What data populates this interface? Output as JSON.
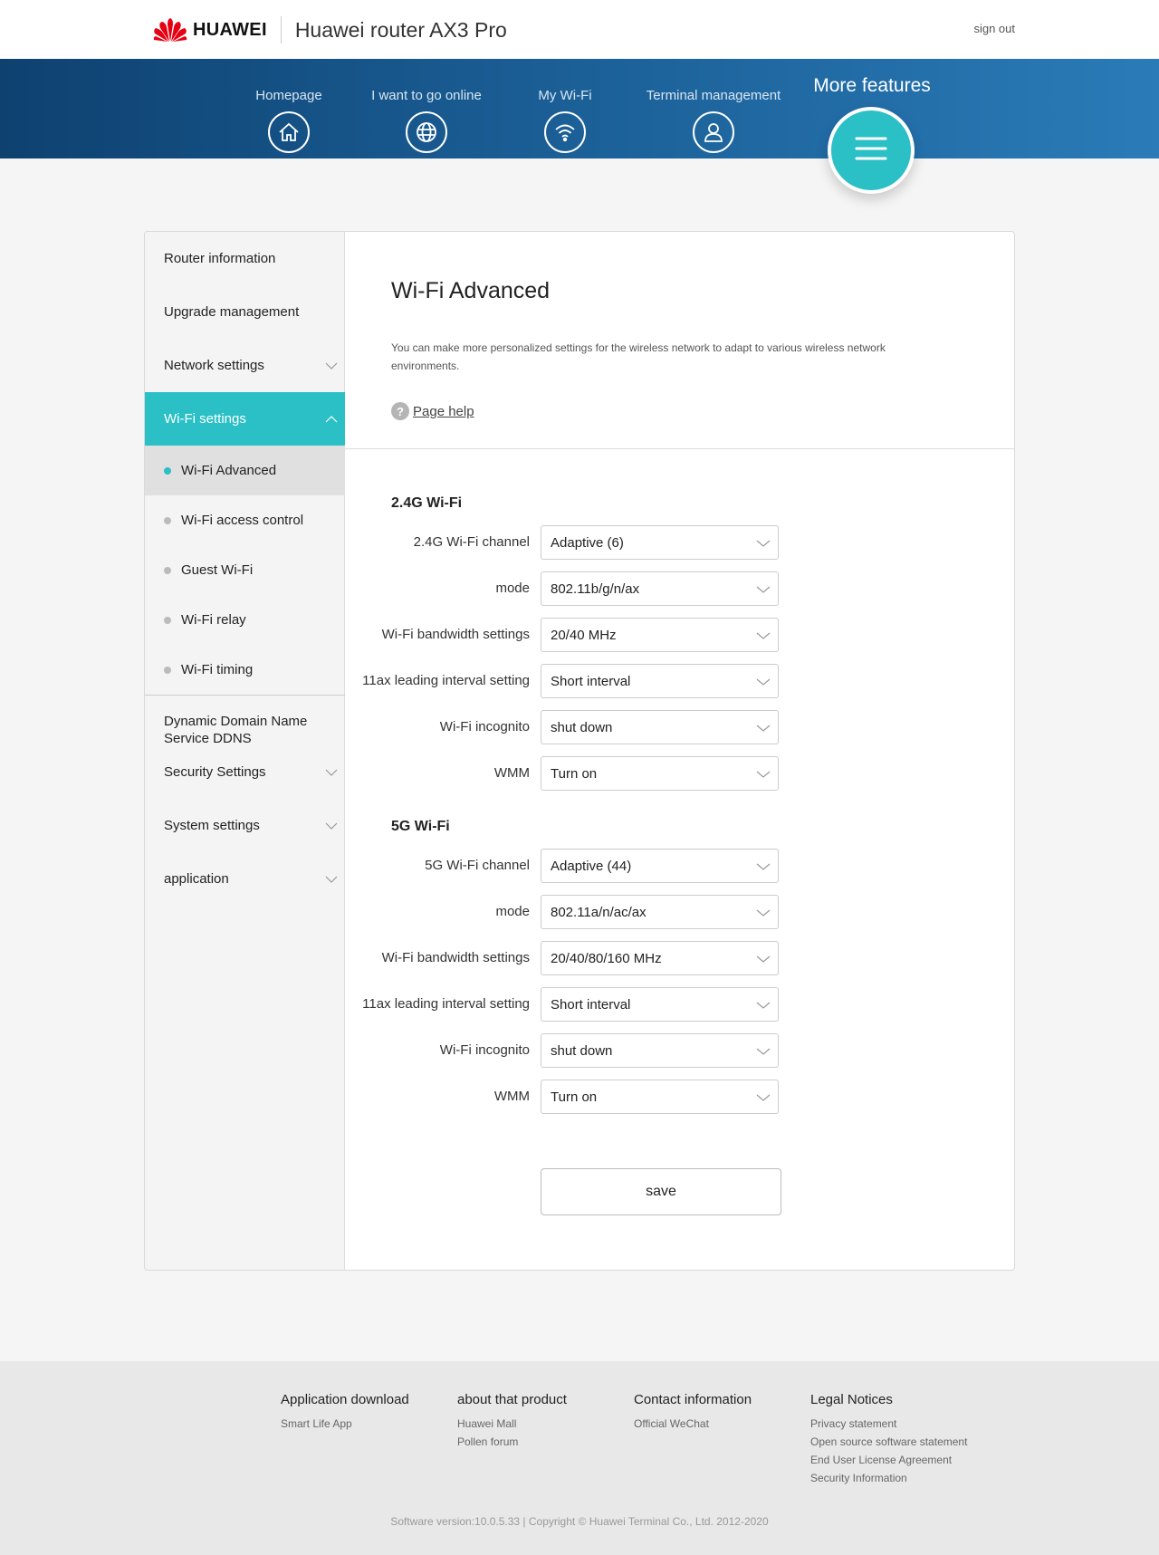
{
  "header": {
    "brand": "HUAWEI",
    "title": "Huawei router AX3 Pro",
    "signout": "sign out"
  },
  "nav": {
    "items": [
      {
        "label": "Homepage",
        "icon": "home-icon"
      },
      {
        "label": "I want to go online",
        "icon": "globe-icon"
      },
      {
        "label": "My Wi-Fi",
        "icon": "wifi-icon"
      },
      {
        "label": "Terminal management",
        "icon": "user-icon"
      }
    ],
    "more_label": "More features",
    "more_icon": "menu-icon"
  },
  "sidebar": {
    "router_info": "Router information",
    "upgrade": "Upgrade management",
    "network": "Network settings",
    "wifi": "Wi-Fi settings",
    "sub": [
      "Wi-Fi Advanced",
      "Wi-Fi access control",
      "Guest Wi-Fi",
      "Wi-Fi relay",
      "Wi-Fi timing"
    ],
    "ddns": "Dynamic Domain Name Service DDNS",
    "security": "Security Settings",
    "system": "System settings",
    "application": "application"
  },
  "page": {
    "title": "Wi-Fi Advanced",
    "description": "You can make more personalized settings for the wireless network to adapt to various wireless network environments.",
    "help": "Page help"
  },
  "wifi24": {
    "title": "2.4G Wi-Fi",
    "rows": [
      {
        "label": "2.4G Wi-Fi channel",
        "value": "Adaptive (6)"
      },
      {
        "label": "mode",
        "value": "802.11b/g/n/ax"
      },
      {
        "label": "Wi-Fi bandwidth settings",
        "value": "20/40 MHz"
      },
      {
        "label": "11ax leading interval setting",
        "value": "Short interval"
      },
      {
        "label": "Wi-Fi incognito",
        "value": "shut down"
      },
      {
        "label": "WMM",
        "value": "Turn on"
      }
    ]
  },
  "wifi5": {
    "title": "5G Wi-Fi",
    "rows": [
      {
        "label": "5G Wi-Fi channel",
        "value": "Adaptive (44)"
      },
      {
        "label": "mode",
        "value": "802.11a/n/ac/ax"
      },
      {
        "label": "Wi-Fi bandwidth settings",
        "value": "20/40/80/160 MHz"
      },
      {
        "label": "11ax leading interval setting",
        "value": "Short interval"
      },
      {
        "label": "Wi-Fi incognito",
        "value": "shut down"
      },
      {
        "label": "WMM",
        "value": "Turn on"
      }
    ]
  },
  "save_label": "save",
  "footer": {
    "cols": [
      {
        "head": "Application download",
        "links": [
          "Smart Life App"
        ]
      },
      {
        "head": "about that product",
        "links": [
          "Huawei Mall",
          "Pollen forum"
        ]
      },
      {
        "head": "Contact information",
        "links": [
          "Official WeChat"
        ]
      },
      {
        "head": "Legal Notices",
        "links": [
          "Privacy statement",
          "Open source software statement",
          "End User License Agreement",
          "Security Information"
        ]
      }
    ],
    "copyright": "Software version:10.0.5.33 |  Copyright © Huawei Terminal Co., Ltd. 2012-2020"
  },
  "colors": {
    "accent": "#2bbfc6",
    "nav_start": "#0e4170",
    "nav_end": "#2a7bb8",
    "brand_red": "#e60012"
  }
}
